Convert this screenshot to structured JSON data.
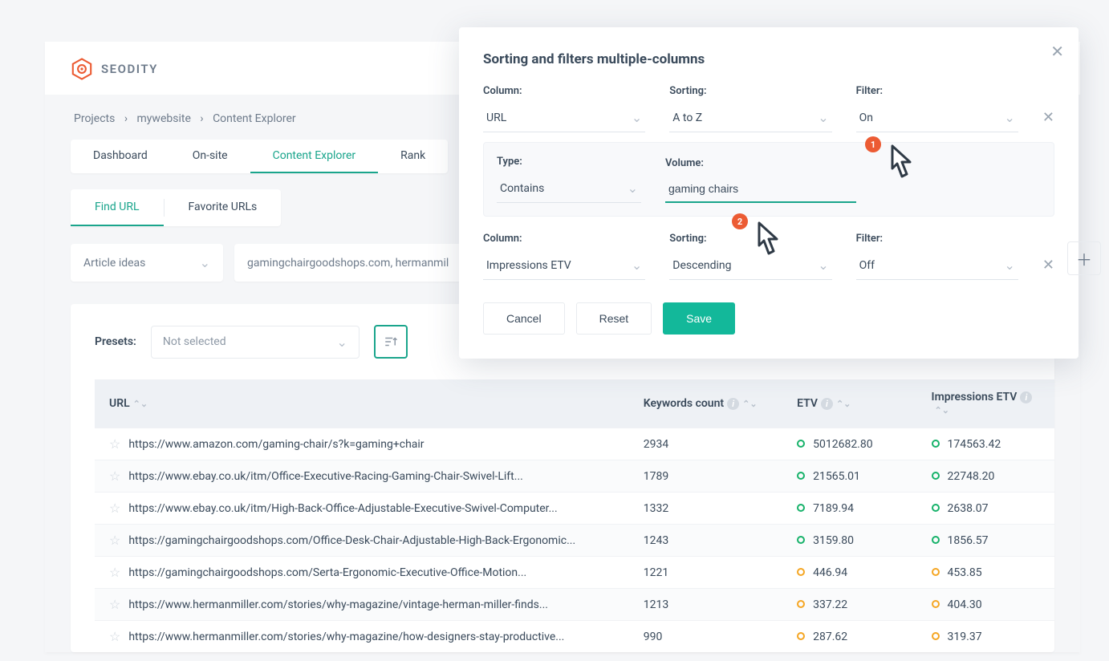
{
  "brand": {
    "name": "SEODITY"
  },
  "breadcrumbs": [
    "Projects",
    "mywebsite",
    "Content Explorer"
  ],
  "tabs": {
    "items": [
      "Dashboard",
      "On-site",
      "Content Explorer",
      "Rank"
    ],
    "activeIndex": 2
  },
  "subtabs": {
    "items": [
      "Find URL",
      "Favorite URLs"
    ],
    "activeIndex": 0
  },
  "filters": {
    "preset_dropdown": "Article ideas",
    "domain_input": "gamingchairgoodshops.com,   hermanmil"
  },
  "presets": {
    "label": "Presets:",
    "value": "Not selected"
  },
  "table": {
    "columns": {
      "url": "URL",
      "kw": "Keywords count",
      "etv": "ETV",
      "imp": "Impressions ETV"
    },
    "rows": [
      {
        "url": "https://www.amazon.com/gaming-chair/s?k=gaming+chair",
        "kw": "2934",
        "etv": "5012682.80",
        "imp": "174563.42",
        "status": "green"
      },
      {
        "url": "https://www.ebay.co.uk/itm/Office-Executive-Racing-Gaming-Chair-Swivel-Lift...",
        "kw": "1789",
        "etv": "21565.01",
        "imp": "22748.20",
        "status": "green"
      },
      {
        "url": "https://www.ebay.co.uk/itm/High-Back-Office-Adjustable-Executive-Swivel-Computer...",
        "kw": "1332",
        "etv": "7189.94",
        "imp": "2638.07",
        "status": "green"
      },
      {
        "url": "https://gamingchairgoodshops.com/Office-Desk-Chair-Adjustable-High-Back-Ergonomic...",
        "kw": "1243",
        "etv": "3159.80",
        "imp": "1856.57",
        "status": "green"
      },
      {
        "url": "https://gamingchairgoodshops.com/Serta-Ergonomic-Executive-Office-Motion...",
        "kw": "1221",
        "etv": "446.94",
        "imp": "453.85",
        "status": "amber"
      },
      {
        "url": "https://www.hermanmiller.com/stories/why-magazine/vintage-herman-miller-finds...",
        "kw": "1213",
        "etv": "337.22",
        "imp": "404.30",
        "status": "amber"
      },
      {
        "url": "https://www.hermanmiller.com/stories/why-magazine/how-designers-stay-productive...",
        "kw": "990",
        "etv": "287.62",
        "imp": "319.37",
        "status": "amber"
      }
    ]
  },
  "modal": {
    "title": "Sorting and filters multiple-columns",
    "labels": {
      "column": "Column:",
      "sorting": "Sorting:",
      "filter": "Filter:",
      "type": "Type:",
      "volume": "Volume:"
    },
    "rules": [
      {
        "column": "URL",
        "sorting": "A to Z",
        "filter": "On",
        "sub": {
          "type": "Contains",
          "volume": "gaming chairs"
        }
      },
      {
        "column": "Impressions ETV",
        "sorting": "Descending",
        "filter": "Off"
      }
    ],
    "buttons": {
      "cancel": "Cancel",
      "reset": "Reset",
      "save": "Save"
    }
  },
  "pointers": {
    "p1": "1",
    "p2": "2"
  }
}
